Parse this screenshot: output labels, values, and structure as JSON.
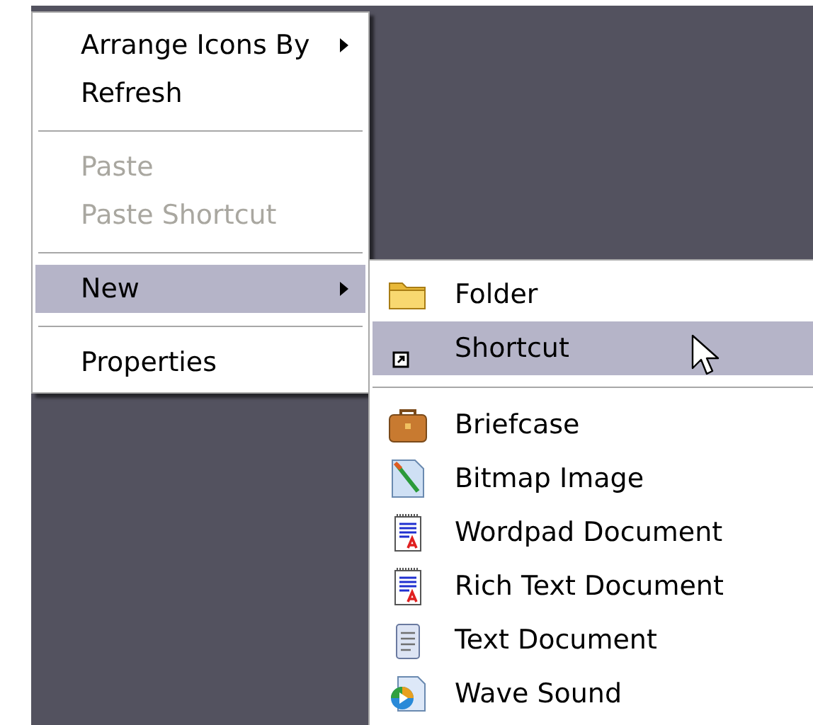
{
  "context_menu": {
    "items": [
      {
        "kind": "item",
        "label": "Arrange Icons By",
        "has_submenu": true,
        "disabled": false,
        "selected": false
      },
      {
        "kind": "item",
        "label": "Refresh",
        "has_submenu": false,
        "disabled": false,
        "selected": false
      },
      {
        "kind": "separator"
      },
      {
        "kind": "item",
        "label": "Paste",
        "has_submenu": false,
        "disabled": true,
        "selected": false
      },
      {
        "kind": "item",
        "label": "Paste Shortcut",
        "has_submenu": false,
        "disabled": true,
        "selected": false
      },
      {
        "kind": "separator"
      },
      {
        "kind": "item",
        "label": "New",
        "has_submenu": true,
        "disabled": false,
        "selected": true
      },
      {
        "kind": "separator"
      },
      {
        "kind": "item",
        "label": "Properties",
        "has_submenu": false,
        "disabled": false,
        "selected": false
      }
    ]
  },
  "new_submenu": {
    "items": [
      {
        "kind": "item",
        "label": "Folder",
        "selected": false
      },
      {
        "kind": "item",
        "label": "Shortcut",
        "selected": true
      },
      {
        "kind": "separator"
      },
      {
        "kind": "item",
        "label": "Briefcase",
        "selected": false
      },
      {
        "kind": "item",
        "label": "Bitmap Image",
        "selected": false
      },
      {
        "kind": "item",
        "label": "Wordpad Document",
        "selected": false
      },
      {
        "kind": "item",
        "label": "Rich Text Document",
        "selected": false
      },
      {
        "kind": "item",
        "label": "Text Document",
        "selected": false
      },
      {
        "kind": "item",
        "label": "Wave Sound",
        "selected": false
      }
    ]
  }
}
